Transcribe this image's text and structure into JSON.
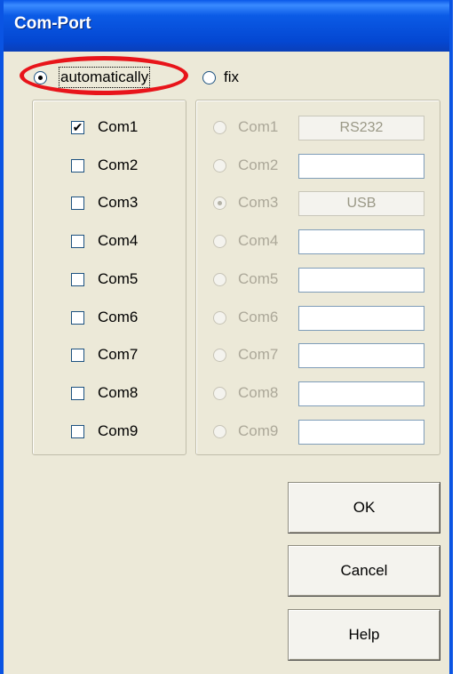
{
  "window": {
    "title": "Com-Port"
  },
  "mode": {
    "automatic_label": "automatically",
    "fix_label": "fix",
    "selected": "automatically"
  },
  "auto_ports": [
    {
      "label": "Com1",
      "checked": true
    },
    {
      "label": "Com2",
      "checked": false
    },
    {
      "label": "Com3",
      "checked": false
    },
    {
      "label": "Com4",
      "checked": false
    },
    {
      "label": "Com5",
      "checked": false
    },
    {
      "label": "Com6",
      "checked": false
    },
    {
      "label": "Com7",
      "checked": false
    },
    {
      "label": "Com8",
      "checked": false
    },
    {
      "label": "Com9",
      "checked": false
    }
  ],
  "fix_ports": [
    {
      "label": "Com1",
      "value": "RS232",
      "selected": false
    },
    {
      "label": "Com2",
      "value": "",
      "selected": false
    },
    {
      "label": "Com3",
      "value": "USB",
      "selected": true
    },
    {
      "label": "Com4",
      "value": "",
      "selected": false
    },
    {
      "label": "Com5",
      "value": "",
      "selected": false
    },
    {
      "label": "Com6",
      "value": "",
      "selected": false
    },
    {
      "label": "Com7",
      "value": "",
      "selected": false
    },
    {
      "label": "Com8",
      "value": "",
      "selected": false
    },
    {
      "label": "Com9",
      "value": "",
      "selected": false
    }
  ],
  "buttons": {
    "ok": "OK",
    "cancel": "Cancel",
    "help": "Help"
  },
  "colors": {
    "title_bar": "#0a54e3",
    "highlight_ring": "#e8141a",
    "dialog_bg": "#ece9d8"
  }
}
